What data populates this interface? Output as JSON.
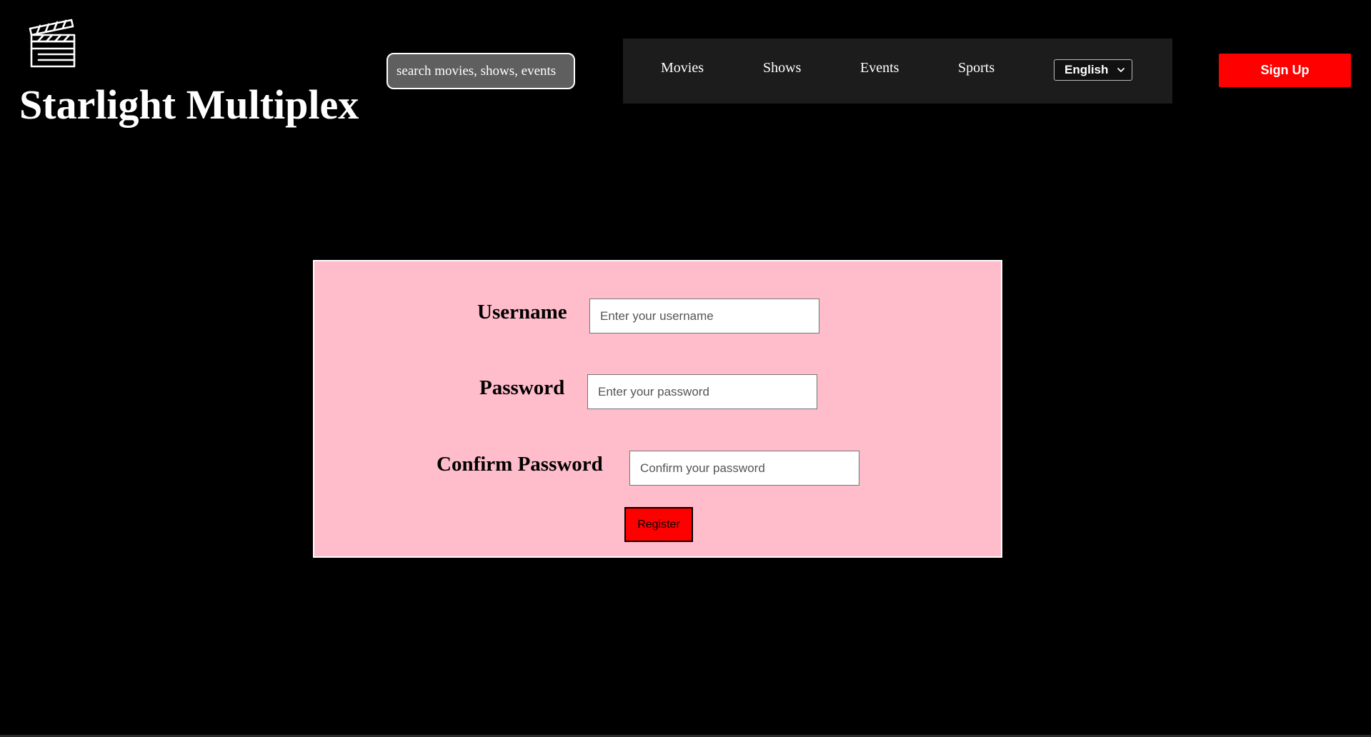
{
  "header": {
    "logo_icon": "clapperboard-icon",
    "brand_title": "Starlight Multiplex",
    "search": {
      "placeholder": "search movies, shows, events",
      "value": ""
    },
    "nav": {
      "items": [
        {
          "label": "Movies"
        },
        {
          "label": "Shows"
        },
        {
          "label": "Events"
        },
        {
          "label": "Sports"
        }
      ],
      "language": {
        "selected": "English",
        "icon": "chevron-down-icon"
      }
    },
    "signup_label": "Sign Up"
  },
  "form": {
    "username": {
      "label": "Username",
      "placeholder": "Enter your username",
      "value": ""
    },
    "password": {
      "label": "Password",
      "placeholder": "Enter your password",
      "value": ""
    },
    "confirm_password": {
      "label": "Confirm Password",
      "placeholder": "Confirm your password",
      "value": ""
    },
    "register_label": "Register"
  },
  "colors": {
    "background": "#000000",
    "nav_background": "#1c1c1c",
    "accent_red": "#ff0000",
    "panel_pink": "#ffbcca",
    "search_gray": "#5f5f5f"
  }
}
